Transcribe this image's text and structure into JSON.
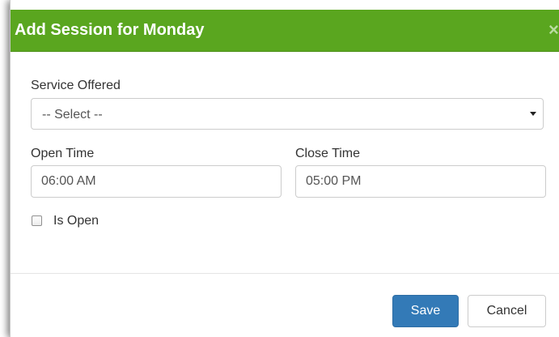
{
  "dialog": {
    "title": "Add Session for Monday",
    "close_symbol": "×"
  },
  "form": {
    "service_label": "Service Offered",
    "service_value": "-- Select --",
    "open_time_label": "Open Time",
    "open_time_value": "06:00 AM",
    "close_time_label": "Close Time",
    "close_time_value": "05:00 PM",
    "is_open_label": "Is Open",
    "is_open_checked": false
  },
  "footer": {
    "save_label": "Save",
    "cancel_label": "Cancel"
  },
  "colors": {
    "header": "#5aa61f",
    "primary": "#337ab7"
  },
  "icons": {
    "close": "close-icon",
    "caret": "caret-down-icon"
  }
}
